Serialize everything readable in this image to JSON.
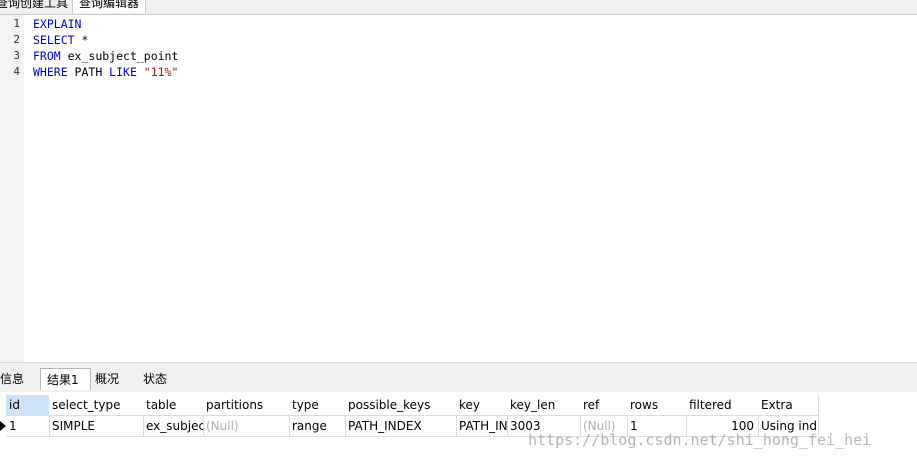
{
  "top_tabs": [
    "查询创建工具",
    "查询编辑器"
  ],
  "editor": {
    "line_numbers": [
      "1",
      "2",
      "3",
      "4"
    ],
    "lines": [
      {
        "kw": "EXPLAIN",
        "rest": "",
        "str": ""
      },
      {
        "kw": "SELECT",
        "rest": " *",
        "str": ""
      },
      {
        "kw": "FROM",
        "rest": " ex_subject_point",
        "str": ""
      },
      {
        "kw": "WHERE",
        "rest": " PATH ",
        "kw2": "LIKE",
        "str": " \"11%\""
      }
    ]
  },
  "bottom_tabs": [
    "信息",
    "结果1",
    "概况",
    "状态"
  ],
  "result": {
    "columns": [
      "id",
      "select_type",
      "table",
      "partitions",
      "type",
      "possible_keys",
      "key",
      "key_len",
      "ref",
      "rows",
      "filtered",
      "Extra"
    ],
    "rows": [
      [
        "1",
        "SIMPLE",
        "ex_subjec",
        "(Null)",
        "range",
        "PATH_INDEX",
        "PATH_IN",
        "3003",
        "(Null)",
        "1",
        "100",
        "Using ind"
      ]
    ]
  },
  "watermark": "https://blog.csdn.net/shi_hong_fei_hei"
}
